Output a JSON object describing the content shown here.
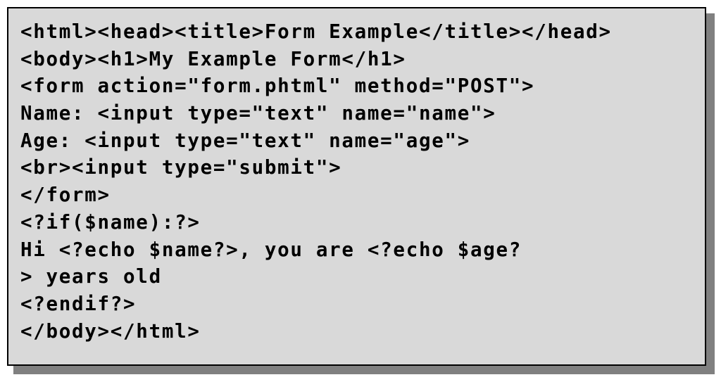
{
  "figure": {
    "kind": "code-listing",
    "language": "PHP-embedded-HTML",
    "colors": {
      "page_background": "#ffffff",
      "box_background": "#d9d9d9",
      "box_border": "#000000",
      "drop_shadow": "#808080",
      "code_text": "#000000"
    }
  },
  "code": {
    "lines": [
      "<html><head><title>Form Example</title></head>",
      "<body><h1>My Example Form</h1>",
      "<form action=\"form.phtml\" method=\"POST\">",
      "Name: <input type=\"text\" name=\"name\">",
      "Age: <input type=\"text\" name=\"age\">",
      "<br><input type=\"submit\">",
      "</form>",
      "<?if($name):?>",
      "Hi <?echo $name?>, you are <?echo $age?",
      "> years old",
      "<?endif?>",
      "</body></html>"
    ]
  }
}
